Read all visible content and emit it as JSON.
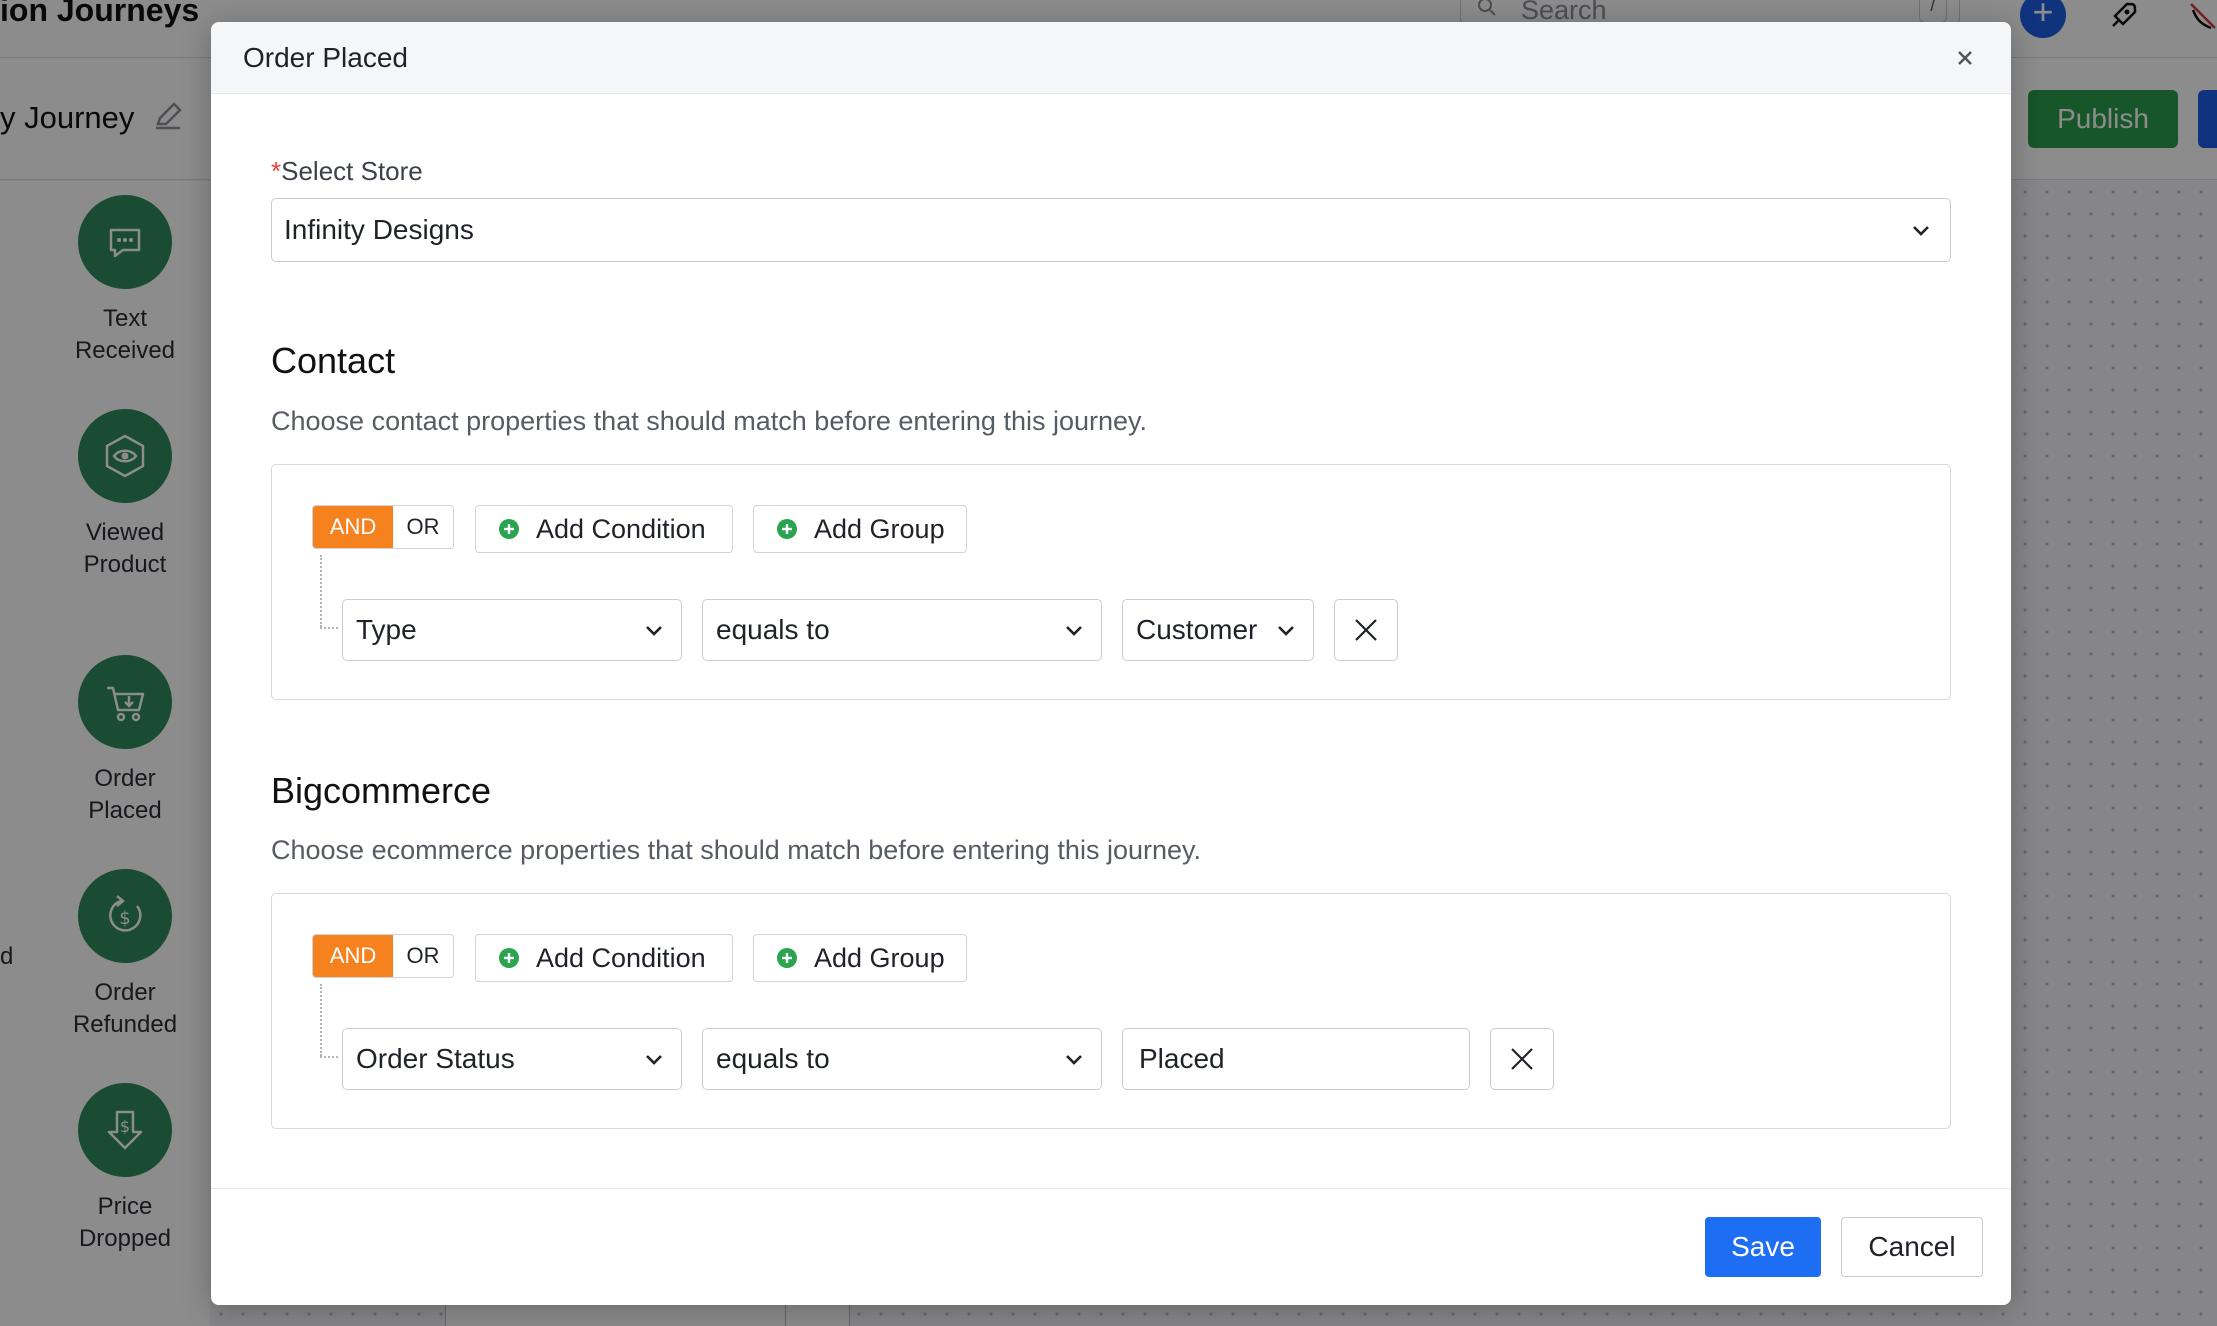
{
  "background": {
    "app_title": "ion Journeys",
    "search_placeholder": "Search",
    "search_shortcut": "/",
    "journey_name": "y Journey",
    "publish_label": "Publish",
    "stray_text": "d",
    "triggers": [
      {
        "label_line1": "Text",
        "label_line2": "Received",
        "icon": "chat-bubble-icon"
      },
      {
        "label_line1": "Viewed",
        "label_line2": "Product",
        "icon": "eye-cube-icon"
      },
      {
        "label_line1": "Order",
        "label_line2": "Placed",
        "icon": "shopping-cart-icon"
      },
      {
        "label_line1": "Order",
        "label_line2": "Refunded",
        "icon": "refund-dollar-icon"
      },
      {
        "label_line1": "Price",
        "label_line2": "Dropped",
        "icon": "price-drop-icon"
      }
    ]
  },
  "modal": {
    "title": "Order Placed",
    "store": {
      "required_mark": "*",
      "label": "Select Store",
      "value": "Infinity Designs"
    },
    "contact": {
      "title": "Contact",
      "description": "Choose contact properties that should match before entering this journey.",
      "logic_and": "AND",
      "logic_or": "OR",
      "add_condition": "Add Condition",
      "add_group": "Add Group",
      "condition": {
        "property": "Type",
        "operator": "equals to",
        "value": "Customer"
      }
    },
    "ecommerce": {
      "title": "Bigcommerce",
      "description": "Choose ecommerce properties that should match before entering this journey.",
      "logic_and": "AND",
      "logic_or": "OR",
      "add_condition": "Add Condition",
      "add_group": "Add Group",
      "condition": {
        "property": "Order Status",
        "operator": "equals to",
        "value": "Placed"
      }
    },
    "footer": {
      "save": "Save",
      "cancel": "Cancel"
    }
  },
  "colors": {
    "accent_blue": "#1d6ef2",
    "logic_active": "#f5821f",
    "add_icon_green": "#2aa44f",
    "publish_green": "#2a9d4b",
    "trigger_green": "#2f8a5b",
    "required_red": "#e2403a"
  }
}
